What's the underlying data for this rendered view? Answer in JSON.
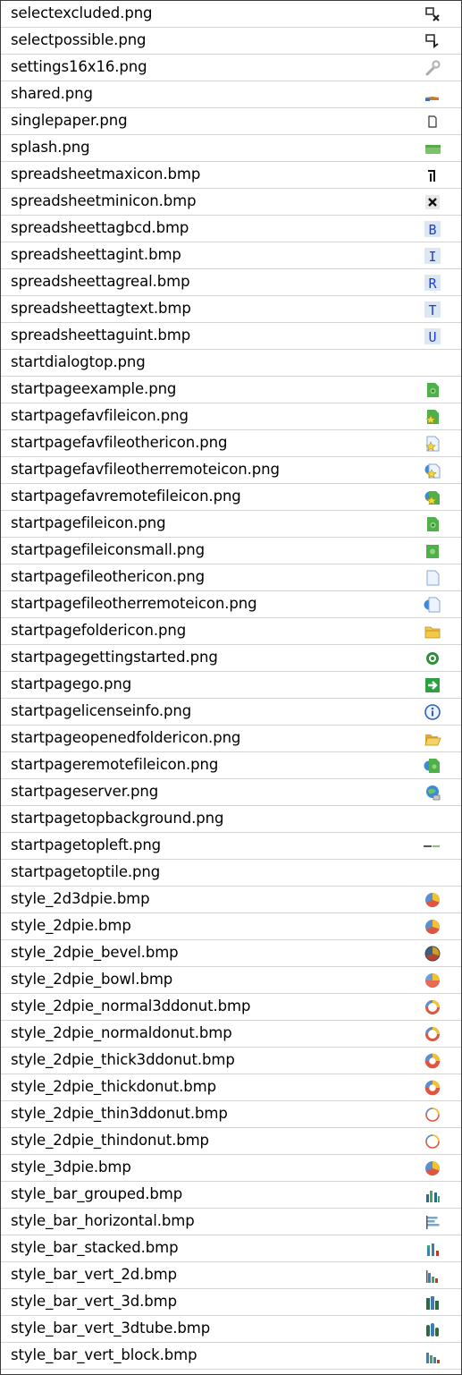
{
  "files": [
    {
      "name": "selectexcluded.png",
      "icon": "select-excluded-icon"
    },
    {
      "name": "selectpossible.png",
      "icon": "select-possible-icon"
    },
    {
      "name": "settings16x16.png",
      "icon": "wrench-icon"
    },
    {
      "name": "shared.png",
      "icon": "shared-hand-icon"
    },
    {
      "name": "singlepaper.png",
      "icon": "single-paper-icon"
    },
    {
      "name": "splash.png",
      "icon": "splash-icon"
    },
    {
      "name": "spreadsheetmaxicon.bmp",
      "icon": "spreadsheet-max-icon"
    },
    {
      "name": "spreadsheetminicon.bmp",
      "icon": "spreadsheet-min-icon"
    },
    {
      "name": "spreadsheettagbcd.bmp",
      "icon": "tag-b-icon",
      "letter": "B"
    },
    {
      "name": "spreadsheettagint.bmp",
      "icon": "tag-i-icon",
      "letter": "I"
    },
    {
      "name": "spreadsheettagreal.bmp",
      "icon": "tag-r-icon",
      "letter": "R"
    },
    {
      "name": "spreadsheettagtext.bmp",
      "icon": "tag-t-icon",
      "letter": "T"
    },
    {
      "name": "spreadsheettaguint.bmp",
      "icon": "tag-u-icon",
      "letter": "U"
    },
    {
      "name": "startdialogtop.png",
      "icon": ""
    },
    {
      "name": "startpageexample.png",
      "icon": "green-file-icon"
    },
    {
      "name": "startpagefavfileicon.png",
      "icon": "fav-file-icon"
    },
    {
      "name": "startpagefavfileothericon.png",
      "icon": "fav-file-other-icon"
    },
    {
      "name": "startpagefavfileotherremoteicon.png",
      "icon": "fav-file-other-remote-icon"
    },
    {
      "name": "startpagefavremotefileicon.png",
      "icon": "fav-remote-file-icon"
    },
    {
      "name": "startpagefileicon.png",
      "icon": "green-file-icon"
    },
    {
      "name": "startpagefileiconsmall.png",
      "icon": "green-file-small-icon"
    },
    {
      "name": "startpagefileothericon.png",
      "icon": "blank-file-icon"
    },
    {
      "name": "startpagefileotherremoteicon.png",
      "icon": "remote-file-other-icon"
    },
    {
      "name": "startpagefoldericon.png",
      "icon": "folder-icon"
    },
    {
      "name": "startpagegettingstarted.png",
      "icon": "getting-started-icon"
    },
    {
      "name": "startpagego.png",
      "icon": "go-arrow-icon"
    },
    {
      "name": "startpagelicenseinfo.png",
      "icon": "info-icon"
    },
    {
      "name": "startpageopenedfoldericon.png",
      "icon": "open-folder-icon"
    },
    {
      "name": "startpageremotefileicon.png",
      "icon": "remote-file-icon"
    },
    {
      "name": "startpageserver.png",
      "icon": "server-globe-icon"
    },
    {
      "name": "startpagetopbackground.png",
      "icon": ""
    },
    {
      "name": "startpagetopleft.png",
      "icon": "top-left-logo-icon"
    },
    {
      "name": "startpagetoptile.png",
      "icon": ""
    },
    {
      "name": "style_2d3dpie.bmp",
      "icon": "pie-icon"
    },
    {
      "name": "style_2dpie.bmp",
      "icon": "pie-icon"
    },
    {
      "name": "style_2dpie_bevel.bmp",
      "icon": "pie-bevel-icon"
    },
    {
      "name": "style_2dpie_bowl.bmp",
      "icon": "pie-bowl-icon"
    },
    {
      "name": "style_2dpie_normal3ddonut.bmp",
      "icon": "donut-icon"
    },
    {
      "name": "style_2dpie_normaldonut.bmp",
      "icon": "donut-icon"
    },
    {
      "name": "style_2dpie_thick3ddonut.bmp",
      "icon": "thick-donut-icon"
    },
    {
      "name": "style_2dpie_thickdonut.bmp",
      "icon": "thick-donut-icon"
    },
    {
      "name": "style_2dpie_thin3ddonut.bmp",
      "icon": "thin-donut-icon"
    },
    {
      "name": "style_2dpie_thindonut.bmp",
      "icon": "thin-donut-icon"
    },
    {
      "name": "style_3dpie.bmp",
      "icon": "pie-icon"
    },
    {
      "name": "style_bar_grouped.bmp",
      "icon": "bar-grouped-icon"
    },
    {
      "name": "style_bar_horizontal.bmp",
      "icon": "bar-horizontal-icon"
    },
    {
      "name": "style_bar_stacked.bmp",
      "icon": "bar-stacked-icon"
    },
    {
      "name": "style_bar_vert_2d.bmp",
      "icon": "bar-vert-2d-icon"
    },
    {
      "name": "style_bar_vert_3d.bmp",
      "icon": "bar-vert-3d-icon"
    },
    {
      "name": "style_bar_vert_3dtube.bmp",
      "icon": "bar-vert-3dtube-icon"
    },
    {
      "name": "style_bar_vert_block.bmp",
      "icon": "bar-vert-block-icon"
    }
  ]
}
